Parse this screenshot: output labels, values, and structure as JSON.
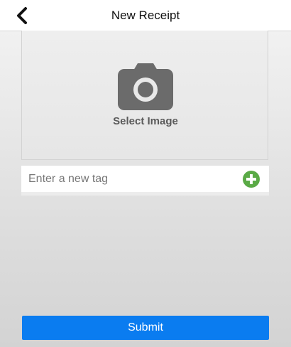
{
  "header": {
    "title": "New Receipt",
    "back_icon": "chevron-left-icon"
  },
  "image_picker": {
    "icon": "camera-icon",
    "label": "Select Image"
  },
  "tag": {
    "placeholder": "Enter a new tag",
    "value": "",
    "add_icon": "plus-circle-icon",
    "add_color": "#5aaa46"
  },
  "actions": {
    "submit_label": "Submit",
    "submit_color": "#0a7cf0"
  }
}
